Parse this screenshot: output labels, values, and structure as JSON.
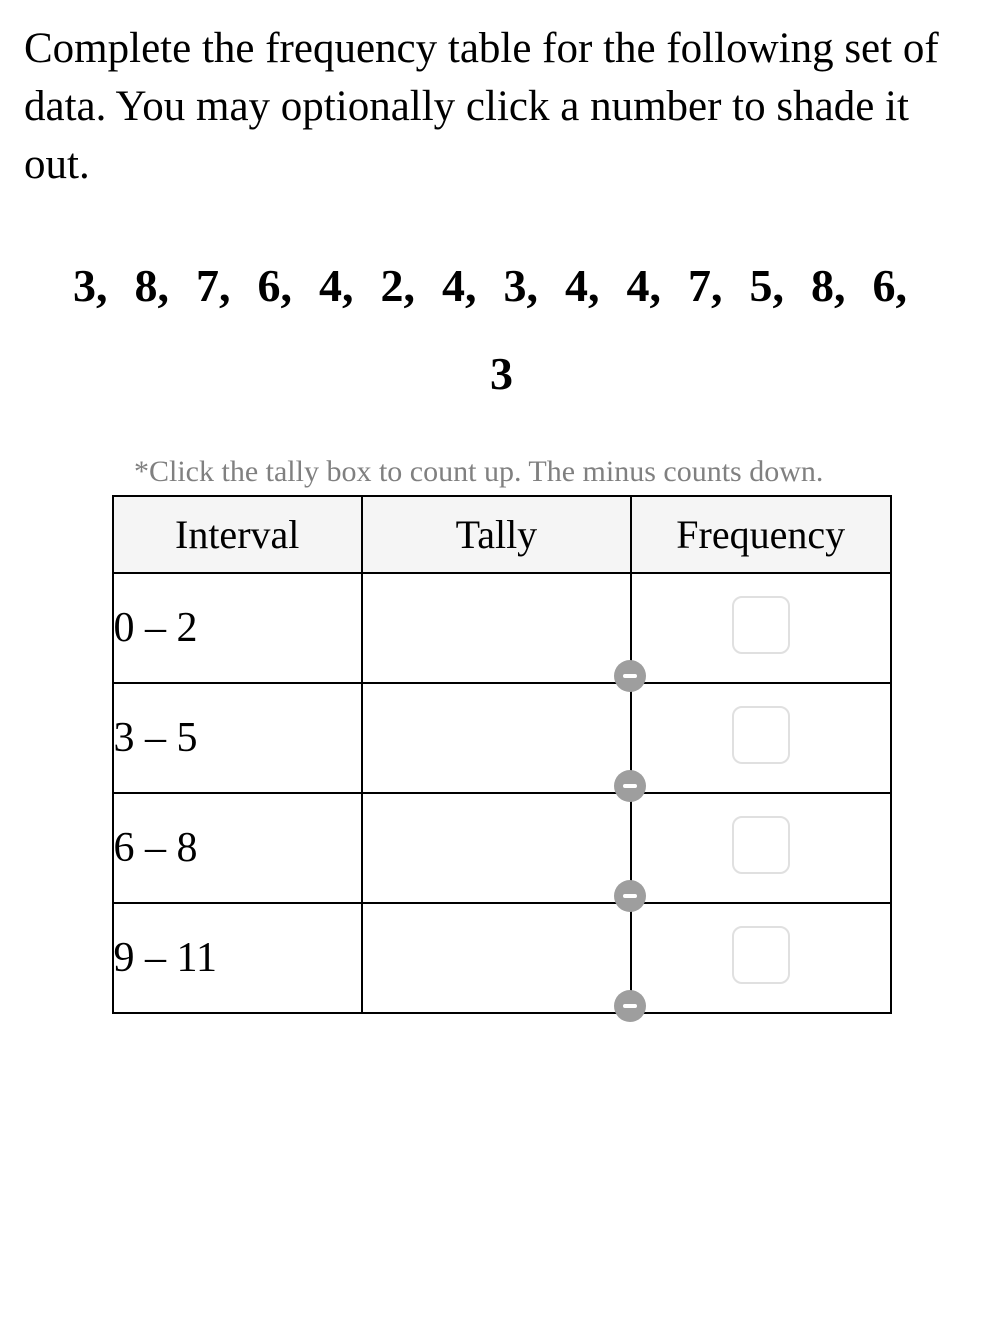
{
  "instructions": "Complete the frequency table for the following set of data. You may optionally click a number to shade it out.",
  "data_numbers": [
    "3",
    "8",
    "7",
    "6",
    "4",
    "2",
    "4",
    "3",
    "4",
    "4",
    "7",
    "5",
    "8",
    "6",
    "3"
  ],
  "hint": "*Click the tally box to count up. The minus counts down.",
  "table": {
    "headers": {
      "interval": "Interval",
      "tally": "Tally",
      "frequency": "Frequency"
    },
    "rows": [
      {
        "interval": "0 – 2",
        "tally": "",
        "frequency": ""
      },
      {
        "interval": "3 – 5",
        "tally": "",
        "frequency": ""
      },
      {
        "interval": "6 – 8",
        "tally": "",
        "frequency": ""
      },
      {
        "interval": "9 – 11",
        "tally": "",
        "frequency": ""
      }
    ]
  }
}
